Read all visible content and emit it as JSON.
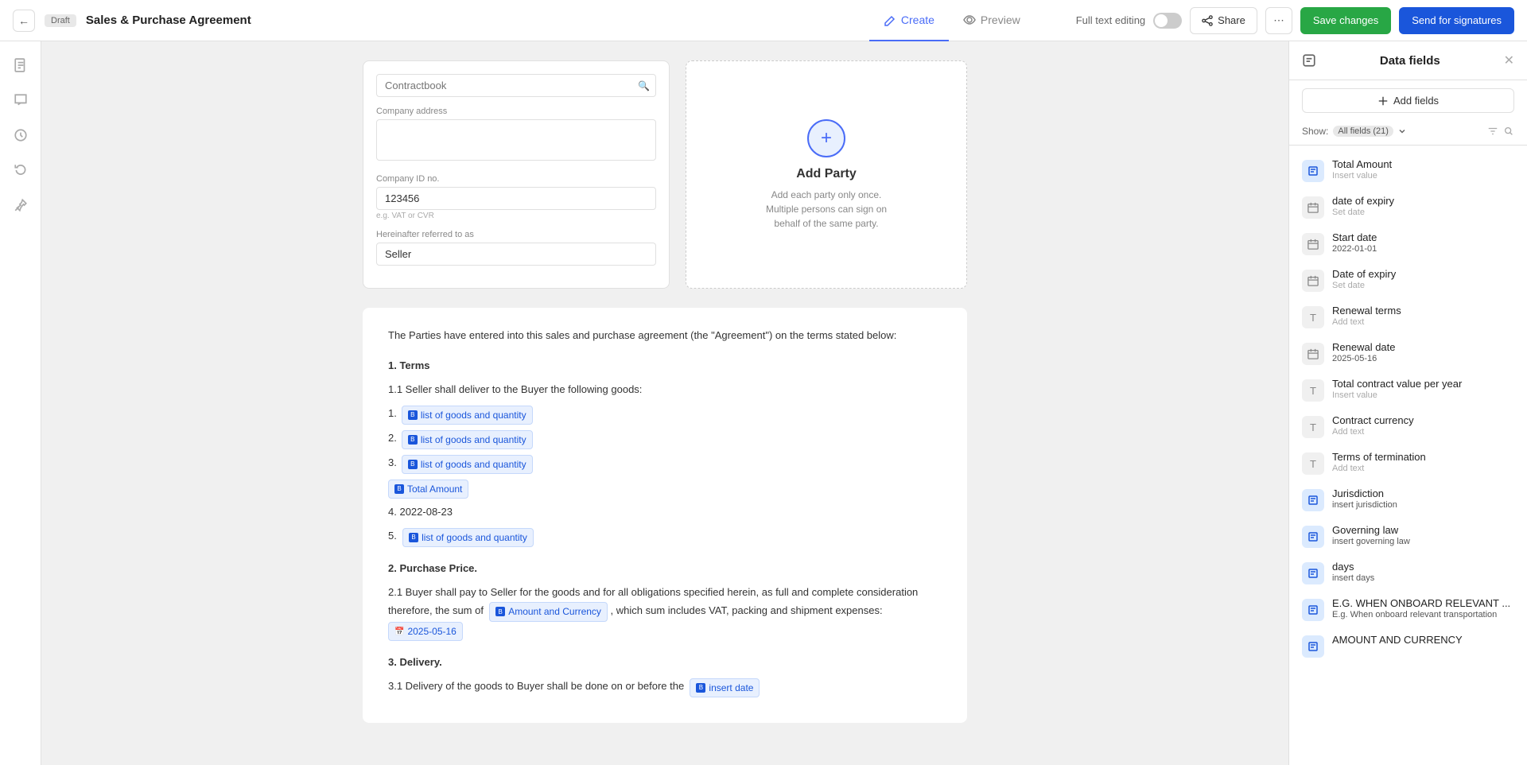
{
  "topbar": {
    "badge": "Draft",
    "title": "Sales & Purchase Agreement",
    "tabs": [
      {
        "id": "create",
        "label": "Create",
        "active": true
      },
      {
        "id": "preview",
        "label": "Preview",
        "active": false
      }
    ],
    "full_text_label": "Full text editing",
    "share_label": "Share",
    "save_label": "Save changes",
    "sign_label": "Send for signatures"
  },
  "party_form": {
    "company_name_label": "",
    "company_name_placeholder": "Contractbook",
    "company_address_label": "Company address",
    "company_id_label": "Company ID no.",
    "company_id_value": "123456",
    "company_id_hint": "e.g. VAT or CVR",
    "referred_as_label": "Hereinafter referred to as",
    "referred_as_value": "Seller"
  },
  "add_party": {
    "title": "Add Party",
    "desc_line1": "Add each party only once.",
    "desc_line2": "Multiple persons can sign on",
    "desc_line3": "behalf of the same party."
  },
  "document": {
    "intro": "The Parties have entered into this sales and purchase agreement (the \"Agreement\") on the terms stated below:",
    "section1_title": "1. Terms",
    "section1_1": "1.1 Seller shall deliver to the Buyer the following goods:",
    "goods_items": [
      {
        "num": "1.",
        "chip": "list of goods and quantity"
      },
      {
        "num": "2.",
        "chip": "list of goods and quantity"
      },
      {
        "num": "3.",
        "chip": "list of goods and quantity"
      }
    ],
    "total_amount_chip": "Total Amount",
    "item4_date": "2022-08-23",
    "item5_chip": "list of goods and quantity",
    "section2_title": "2. Purchase Price.",
    "section2_1_start": "2.1 Buyer shall pay to Seller for the goods and for all obligations specified herein, as full and complete consideration therefore, the sum of",
    "amount_chip": "Amount and Currency",
    "section2_1_mid": ", which sum includes VAT, packing and shipment expenses:",
    "date_chip": "2025-05-16",
    "section3_title": "3. Delivery.",
    "section3_1_start": "3.1 Delivery of the goods to Buyer shall be done on or before the",
    "insert_date_chip": "insert date"
  },
  "data_fields_panel": {
    "title": "Data fields",
    "add_fields_label": "Add fields",
    "show_label": "Show:",
    "show_filter": "All fields (21)",
    "fields": [
      {
        "id": "total-amount",
        "name": "Total Amount",
        "value": "Insert value",
        "type": "blue",
        "icon": "B"
      },
      {
        "id": "date-of-expiry-1",
        "name": "date of expiry",
        "value": "Set date",
        "type": "gray",
        "icon": "📅"
      },
      {
        "id": "start-date",
        "name": "Start date",
        "value": "2022-01-01",
        "type": "gray",
        "icon": "📅",
        "value_set": true
      },
      {
        "id": "date-of-expiry-2",
        "name": "Date of expiry",
        "value": "Set date",
        "type": "gray",
        "icon": "📅"
      },
      {
        "id": "renewal-terms",
        "name": "Renewal terms",
        "value": "Add text",
        "type": "gray",
        "icon": "T"
      },
      {
        "id": "renewal-date",
        "name": "Renewal date",
        "value": "2025-05-16",
        "type": "gray",
        "icon": "📅",
        "value_set": true
      },
      {
        "id": "total-contract-value",
        "name": "Total contract value per year",
        "value": "Insert value",
        "type": "gray",
        "icon": "T"
      },
      {
        "id": "contract-currency",
        "name": "Contract currency",
        "value": "Add text",
        "type": "gray",
        "icon": "T"
      },
      {
        "id": "terms-of-termination",
        "name": "Terms of termination",
        "value": "Add text",
        "type": "gray",
        "icon": "T"
      },
      {
        "id": "jurisdiction",
        "name": "Jurisdiction",
        "value": "insert jurisdiction",
        "type": "blue",
        "icon": "B",
        "value_set": true
      },
      {
        "id": "governing-law",
        "name": "Governing law",
        "value": "insert governing law",
        "type": "blue",
        "icon": "B",
        "value_set": true
      },
      {
        "id": "days",
        "name": "days",
        "value": "insert days",
        "type": "blue",
        "icon": "B",
        "value_set": true
      },
      {
        "id": "eg-onboard",
        "name": "E.G. WHEN ONBOARD RELEVANT ...",
        "value": "E.g. When onboard relevant transportation",
        "type": "blue",
        "icon": "B",
        "value_set": true
      },
      {
        "id": "amount-currency",
        "name": "AMOUNT AND CURRENCY",
        "value": "",
        "type": "blue",
        "icon": "B"
      }
    ]
  }
}
